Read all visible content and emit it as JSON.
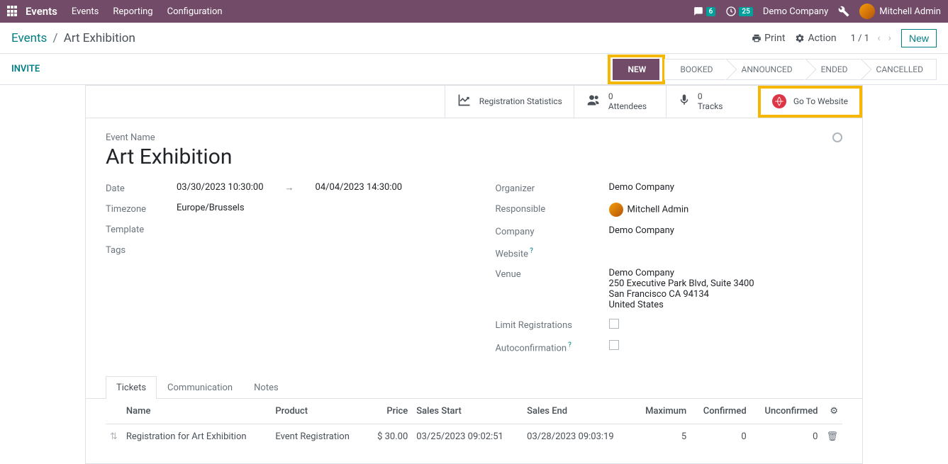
{
  "topbar": {
    "brand": "Events",
    "menu": [
      "Events",
      "Reporting",
      "Configuration"
    ],
    "chat_badge": "6",
    "timer_badge": "25",
    "company": "Demo Company",
    "user": "Mitchell Admin"
  },
  "controlbar": {
    "breadcrumb_root": "Events",
    "breadcrumb_current": "Art Exhibition",
    "print": "Print",
    "action": "Action",
    "pager": "1 / 1",
    "new_btn": "New"
  },
  "statusbar": {
    "invite": "INVITE",
    "steps": [
      "NEW",
      "BOOKED",
      "ANNOUNCED",
      "ENDED",
      "CANCELLED"
    ]
  },
  "stats": {
    "reg": "Registration Statistics",
    "attendees_n": "0",
    "attendees_l": "Attendees",
    "tracks_n": "0",
    "tracks_l": "Tracks",
    "goto": "Go To Website"
  },
  "form": {
    "name_label": "Event Name",
    "name": "Art Exhibition",
    "date_label": "Date",
    "date_start": "03/30/2023 10:30:00",
    "date_end": "04/04/2023 14:30:00",
    "tz_label": "Timezone",
    "tz": "Europe/Brussels",
    "template_label": "Template",
    "tags_label": "Tags",
    "organizer_label": "Organizer",
    "organizer": "Demo Company",
    "responsible_label": "Responsible",
    "responsible": "Mitchell Admin",
    "company_label": "Company",
    "company": "Demo Company",
    "website_label": "Website",
    "venue_label": "Venue",
    "venue_name": "Demo Company",
    "venue_street": "250 Executive Park Blvd, Suite 3400",
    "venue_city": "San Francisco CA 94134",
    "venue_country": "United States",
    "limit_label": "Limit Registrations",
    "autoconf_label": "Autoconfirmation"
  },
  "tabs": [
    "Tickets",
    "Communication",
    "Notes"
  ],
  "tickets": {
    "headers": {
      "name": "Name",
      "product": "Product",
      "price": "Price",
      "start": "Sales Start",
      "end": "Sales End",
      "max": "Maximum",
      "confirmed": "Confirmed",
      "unconfirmed": "Unconfirmed"
    },
    "rows": [
      {
        "name": "Registration for Art Exhibition",
        "product": "Event Registration",
        "price": "$ 30.00",
        "start": "03/25/2023 09:02:51",
        "end": "03/28/2023 09:03:19",
        "max": "5",
        "confirmed": "0",
        "unconfirmed": "0"
      }
    ]
  }
}
